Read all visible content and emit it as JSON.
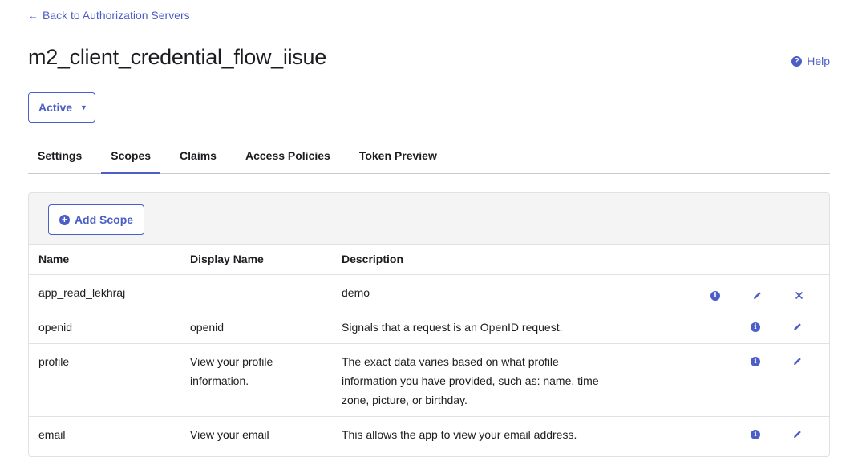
{
  "nav": {
    "back_label": "Back to Authorization Servers"
  },
  "header": {
    "title": "m2_client_credential_flow_iisue",
    "help_label": "Help"
  },
  "status": {
    "value": "Active"
  },
  "tabs": [
    {
      "label": "Settings"
    },
    {
      "label": "Scopes"
    },
    {
      "label": "Claims"
    },
    {
      "label": "Access Policies"
    },
    {
      "label": "Token Preview"
    }
  ],
  "toolbar": {
    "add_scope_label": "Add Scope"
  },
  "table": {
    "columns": [
      "Name",
      "Display Name",
      "Description"
    ],
    "rows": [
      {
        "name": "app_read_lekhraj",
        "display": "",
        "description": "demo",
        "actions": [
          "info",
          "edit",
          "delete"
        ]
      },
      {
        "name": "openid",
        "display": "openid",
        "description": "Signals that a request is an OpenID request.",
        "actions": [
          "info",
          "edit"
        ]
      },
      {
        "name": "profile",
        "display": "View your profile information.",
        "description": "The exact data varies based on what profile information you have provided, such as: name, time zone, picture, or birthday.",
        "actions": [
          "info",
          "edit"
        ]
      },
      {
        "name": "email",
        "display": "View your email",
        "description": "This allows the app to view your email address.",
        "actions": [
          "info",
          "edit"
        ]
      }
    ]
  },
  "colors": {
    "accent": "#4b5ec7",
    "toolbar_bg": "#f4f4f5",
    "border": "#e1e1e4"
  }
}
